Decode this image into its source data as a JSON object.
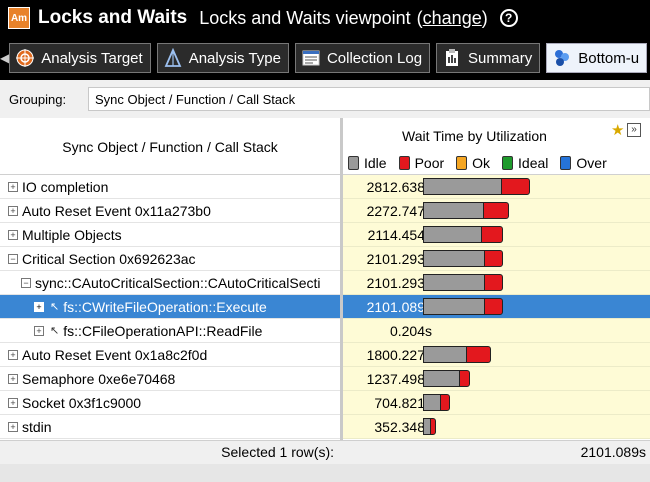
{
  "titlebar": {
    "logo_text": "Am",
    "title": "Locks and Waits",
    "viewpoint_label": "Locks and Waits viewpoint",
    "paren_open": "(",
    "change_link": "change",
    "paren_close": ")",
    "help_icon": "?"
  },
  "tabs": [
    {
      "label": "Analysis Target",
      "icon": "target-icon"
    },
    {
      "label": "Analysis Type",
      "icon": "analysis-type-icon"
    },
    {
      "label": "Collection Log",
      "icon": "log-icon"
    },
    {
      "label": "Summary",
      "icon": "summary-icon"
    },
    {
      "label": "Bottom-u",
      "icon": "bottom-up-icon"
    }
  ],
  "grouping": {
    "label": "Grouping:",
    "value": "Sync Object / Function / Call Stack"
  },
  "grid": {
    "col_name_header": "Sync Object / Function / Call Stack",
    "col_wait_header": "Wait Time by Utilization",
    "legend": [
      {
        "label": "Idle",
        "color": "#9a9a9a"
      },
      {
        "label": "Poor",
        "color": "#e3181e"
      },
      {
        "label": "Ok",
        "color": "#f5a623"
      },
      {
        "label": "Ideal",
        "color": "#1e9a2c"
      },
      {
        "label": "Over",
        "color": "#2573d9"
      }
    ],
    "rows": [
      {
        "name": "IO completion",
        "value": "2812.638s",
        "seconds": 2812.638,
        "idle_fraction": 0.73,
        "expander": "+"
      },
      {
        "name": "Auto Reset Event 0x11a273b0",
        "value": "2272.747s",
        "seconds": 2272.747,
        "idle_fraction": 0.7,
        "expander": "+"
      },
      {
        "name": "Multiple Objects",
        "value": "2114.454s",
        "seconds": 2114.454,
        "idle_fraction": 0.72,
        "expander": "+"
      },
      {
        "name": "Critical Section 0x692623ac",
        "value": "2101.293s",
        "seconds": 2101.293,
        "idle_fraction": 0.76,
        "expander": "−"
      },
      {
        "name": "sync::CAutoCriticalSection::CAutoCriticalSecti",
        "value": "2101.293s",
        "seconds": 2101.293,
        "idle_fraction": 0.76,
        "expander": "−"
      },
      {
        "name": "fs::CWriteFileOperation::Execute",
        "value": "2101.089s",
        "seconds": 2101.089,
        "idle_fraction": 0.76,
        "expander": "+"
      },
      {
        "name": "fs::CFileOperationAPI::ReadFile",
        "value": "0.204s",
        "seconds": 0.204,
        "idle_fraction": 0.0,
        "expander": "+"
      },
      {
        "name": "Auto Reset Event 0x1a8c2f0d",
        "value": "1800.227s",
        "seconds": 1800.227,
        "idle_fraction": 0.63,
        "expander": "+"
      },
      {
        "name": "Semaphore 0xe6e70468",
        "value": "1237.498s",
        "seconds": 1237.498,
        "idle_fraction": 0.76,
        "expander": "+"
      },
      {
        "name": "Socket 0x3f1c9000",
        "value": "704.821s",
        "seconds": 704.821,
        "idle_fraction": 0.62,
        "expander": "+"
      },
      {
        "name": "stdin",
        "value": "352.348s",
        "seconds": 352.348,
        "idle_fraction": 0.55,
        "expander": "+"
      }
    ],
    "selected_index": 5,
    "footer_left": "Selected 1 row(s):",
    "footer_right": "2101.089s"
  }
}
